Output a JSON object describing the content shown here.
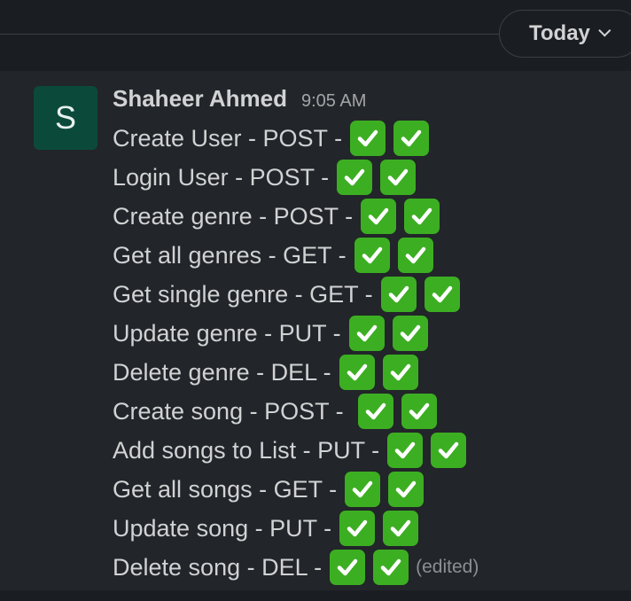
{
  "date_divider": {
    "label": "Today"
  },
  "message": {
    "avatar_letter": "S",
    "sender": "Shaheer Ahmed",
    "time": "9:05 AM",
    "lines": [
      "Create User - POST -",
      "Login User - POST -",
      "Create genre - POST -",
      "Get all genres - GET -",
      "Get single genre - GET -",
      "Update genre - PUT -",
      "Delete genre - DEL -",
      "Create song - POST - ",
      "Add songs to List - PUT -",
      "Get all songs - GET -",
      "Update song - PUT -",
      "Delete song - DEL -"
    ],
    "checks_per_line": 2,
    "check_emoji": "white-heavy-check-mark-icon",
    "edited_label": "(edited)"
  },
  "colors": {
    "background": "#1a1d21",
    "message_bg": "#222529",
    "avatar_bg": "#0b4a3b",
    "check_green": "#3cae22",
    "text": "#d1d2d3",
    "muted": "#a4a5a7"
  }
}
